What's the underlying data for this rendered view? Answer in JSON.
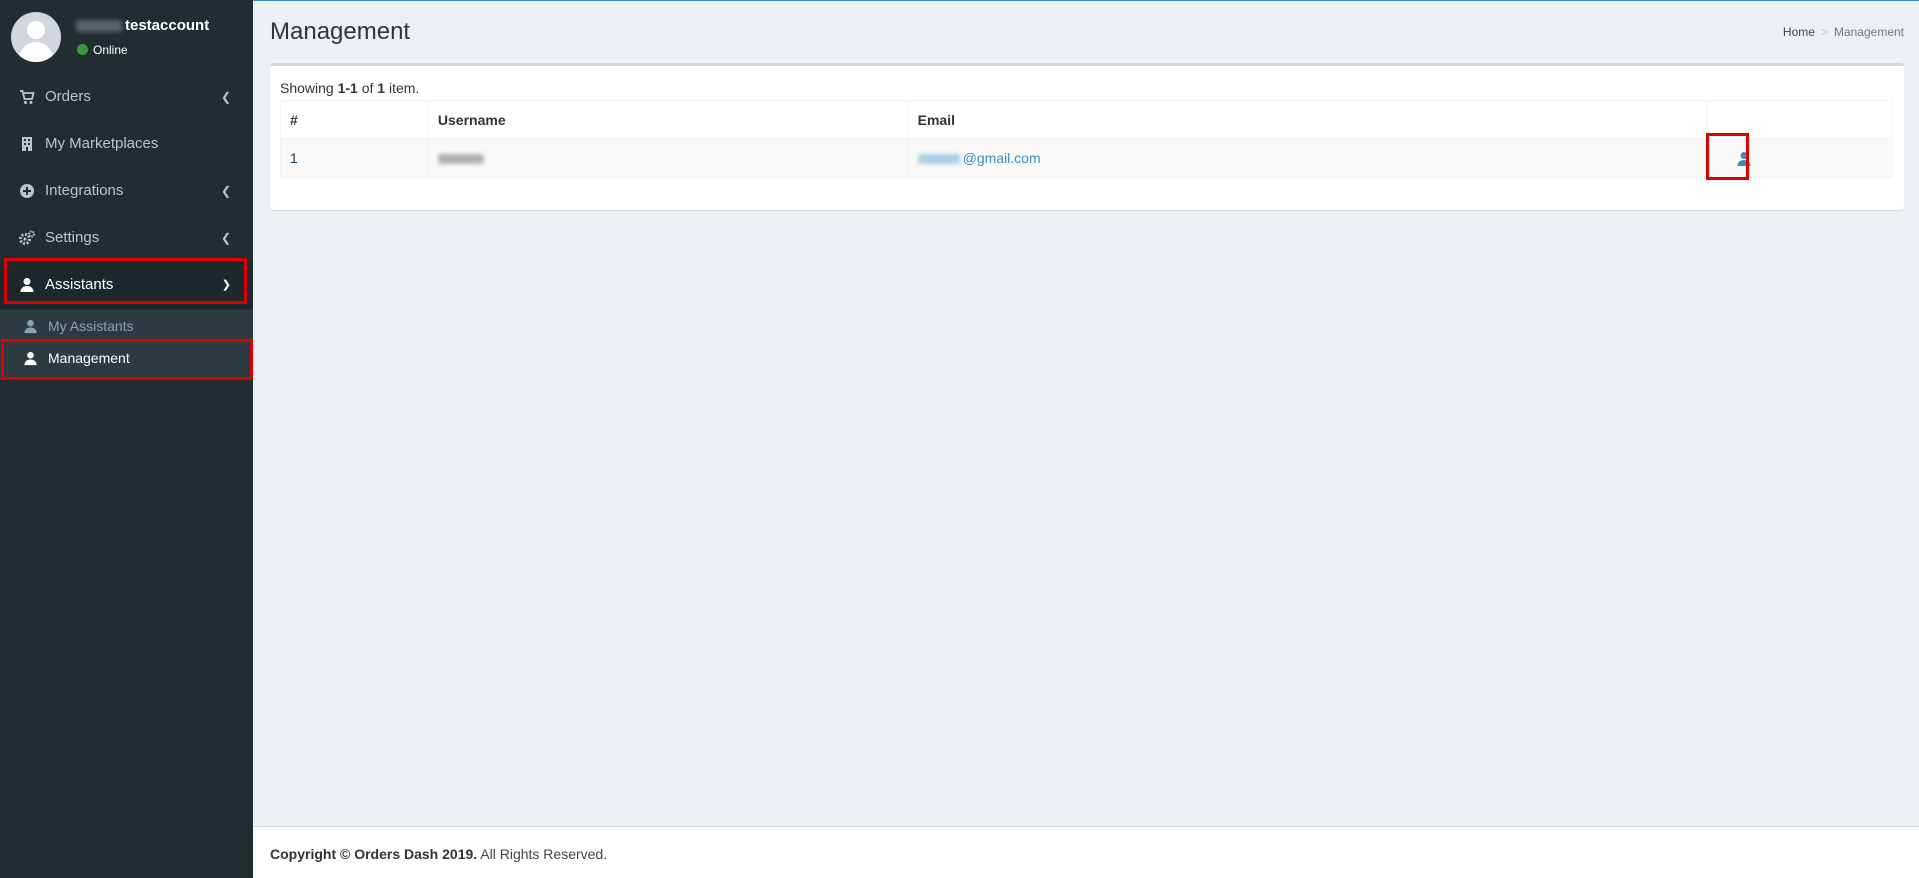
{
  "user": {
    "name": "testaccount",
    "status": "Online"
  },
  "sidebar": {
    "items": [
      {
        "label": "Orders",
        "icon": "cart-icon"
      },
      {
        "label": "My Marketplaces",
        "icon": "building-icon"
      },
      {
        "label": "Integrations",
        "icon": "plus-circle-icon"
      },
      {
        "label": "Settings",
        "icon": "gears-icon"
      },
      {
        "label": "Assistants",
        "icon": "user-icon"
      }
    ],
    "submenu": [
      {
        "label": "My Assistants",
        "icon": "user-icon"
      },
      {
        "label": "Management",
        "icon": "user-icon"
      }
    ]
  },
  "header": {
    "title": "Management"
  },
  "breadcrumb": {
    "home": "Home",
    "separator": ">",
    "current": "Management"
  },
  "summary": {
    "prefix": "Showing ",
    "range": "1-1",
    "middle": " of ",
    "total": "1",
    "suffix": " item."
  },
  "table": {
    "headers": [
      "#",
      "Username",
      "Email",
      ""
    ],
    "rows": [
      {
        "num": "1",
        "email_domain": "@gmail.com",
        "action_icon": "user-icon"
      }
    ]
  },
  "footer": {
    "bold": "Copyright © Orders Dash 2019.",
    "rest": " All Rights Reserved."
  },
  "colors": {
    "sidebar_bg": "#222d32",
    "active_bg": "#1e282c",
    "submenu_bg": "#2c3b41",
    "link": "#3c8dbc",
    "highlight": "#e00000",
    "status_online": "#3c9a3c"
  }
}
